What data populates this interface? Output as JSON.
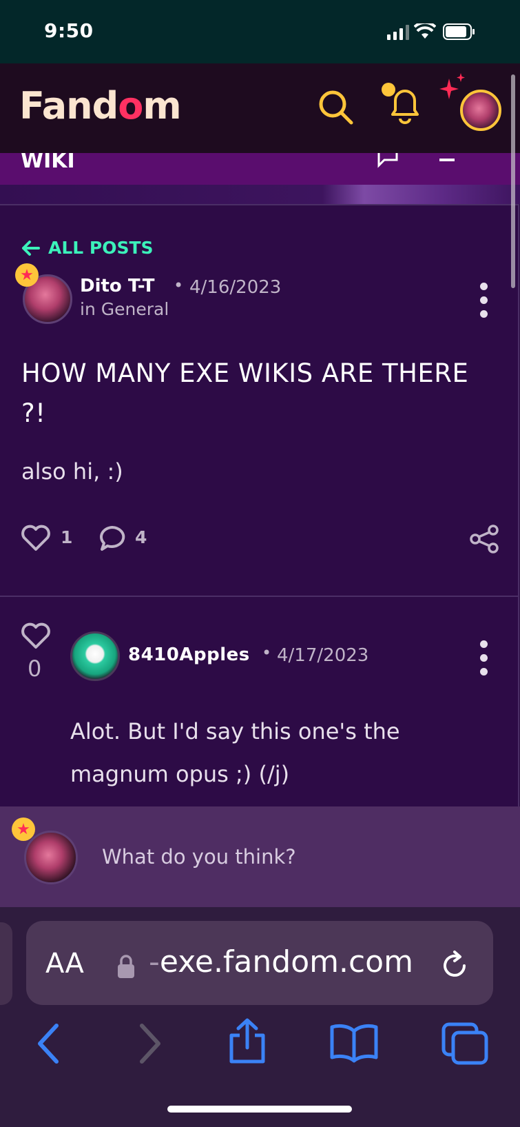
{
  "status_bar": {
    "time": "9:50"
  },
  "header": {
    "logo_prefix": "Fand",
    "logo_heart": "o",
    "logo_suffix": "m",
    "icons": [
      "search-icon",
      "notification-bell-icon",
      "user-avatar-icon"
    ]
  },
  "wiki_banner": {
    "title": "WIKI"
  },
  "post": {
    "back_label": "ALL POSTS",
    "author": "Dito T-T",
    "separator": "•",
    "date": "4/16/2023",
    "category": "in General",
    "title": "HOW MANY EXE WIKIS ARE THERE ?!",
    "body": "also hi, :)",
    "like_count": "1",
    "comment_count": "4"
  },
  "reply": {
    "like_count": "0",
    "author": "8410Apples",
    "separator": "•",
    "date": "4/17/2023",
    "body": "Alot. But I'd say this one's the magnum opus ;) (/j)"
  },
  "composer": {
    "placeholder": "What do you think?"
  },
  "browser": {
    "aa_label": "AA",
    "url_prefix": "-",
    "url": "exe.fandom.com"
  },
  "colors": {
    "accent_teal": "#3cf2ba",
    "fandom_yellow": "#fec53a",
    "fandom_pink": "#ff3162",
    "safari_blue": "#3b82f6"
  }
}
